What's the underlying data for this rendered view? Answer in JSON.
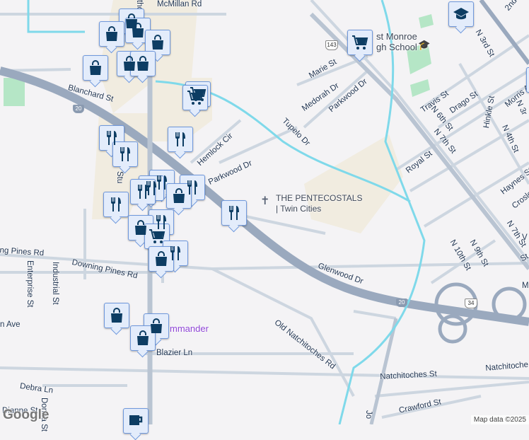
{
  "colors": {
    "background": "#f4f3f5",
    "highway": "#9aa9be",
    "road": "#cdd6e0",
    "water": "#7fd9ea",
    "commercial": "#f1ece0",
    "park": "#b5e6c6",
    "marker_bg": "#e3ecfb",
    "marker_icon": "#0d3d63"
  },
  "roads": {
    "mcmillan": "McMillan Rd",
    "blanchard": "Blanchard St",
    "hemlock": "Hemlock Cir",
    "parkwood": "Parkwood Dr",
    "parkwood2": "Parkwood Dr",
    "downing1": "ng Pines Rd",
    "downing2": "Downing Pines Rd",
    "enterprise": "Enterprise St",
    "industrial": "Industrial St",
    "ave": "n Ave",
    "blazier": "Blazier Ln",
    "debra": "Debra Ln",
    "dianne": "Dianne St",
    "donna": "Donna St",
    "glenwood": "Glenwood Dr",
    "old_natch": "Old Natchitoches Rd",
    "natch": "Natchitoches St",
    "natch2": "Natchitoche",
    "crawford": "Crawford St",
    "marie": "Marie St",
    "medorah": "Medorah Dr",
    "tupelo": "Tupelo Dr",
    "travis": "Travis St",
    "drago": "Drago St",
    "n6": "N 6th St",
    "hinkle": "Hinkle St",
    "morris": "Morris Av",
    "n3": "N 3r",
    "n4": "N 4th St",
    "n7": "N 7th St",
    "n7b": "N 7th St",
    "royal": "Royal St",
    "haynes": "Haynes St",
    "crosley": "Crosle",
    "n10": "N 10th St",
    "n9": "N 9th St",
    "n2": "2nd St",
    "n3b": "N 3rd St",
    "thom": "thom",
    "stu": "Stu",
    "st": "St",
    "v": "V",
    "m": "M",
    "jo": "Jo"
  },
  "shields": {
    "i20a": "20",
    "i20b": "20",
    "la143": "143",
    "us34": "34"
  },
  "places": {
    "pentecostals_1": "THE PENTECOSTALS",
    "pentecostals_2": "| Twin Cities",
    "school": "st Monroe\ngh School",
    "commander": "mmander"
  },
  "footer": {
    "logo": "Google",
    "attribution": "Map data ©2025"
  }
}
